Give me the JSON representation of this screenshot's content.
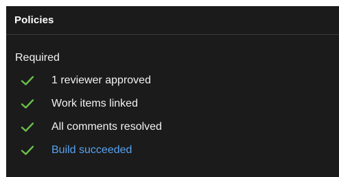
{
  "panel": {
    "title": "Policies"
  },
  "required": {
    "label": "Required",
    "items": [
      {
        "label": "1 reviewer approved",
        "status": "passed",
        "icon": "check-icon",
        "is_link": false
      },
      {
        "label": "Work items linked",
        "status": "passed",
        "icon": "check-icon",
        "is_link": false
      },
      {
        "label": "All comments resolved",
        "status": "passed",
        "icon": "check-icon",
        "is_link": false
      },
      {
        "label": "Build succeeded",
        "status": "passed",
        "icon": "check-icon",
        "is_link": true
      }
    ]
  },
  "colors": {
    "panel_background": "#1b1b1b",
    "check_green": "#6cc04a",
    "link_blue": "#57a3f0",
    "text": "#f2f2f2"
  }
}
